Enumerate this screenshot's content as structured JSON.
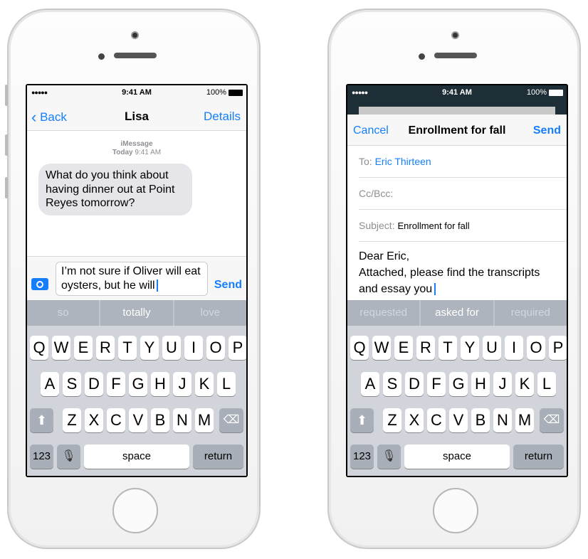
{
  "phones": [
    {
      "status": {
        "time": "9:41 AM",
        "battery": "100%"
      },
      "nav": {
        "back": "Back",
        "title": "Lisa",
        "right": "Details"
      },
      "thread": {
        "service": "iMessage",
        "day": "Today",
        "time": "9:41 AM",
        "incoming": "What do you think about having dinner out at Point Reyes tomorrow?"
      },
      "compose": {
        "text": "I’m not sure if Oliver will eat oysters, but he will",
        "send": "Send"
      },
      "suggestions": [
        "so",
        "totally",
        "love"
      ]
    },
    {
      "status": {
        "time": "9:41 AM",
        "battery": "100%"
      },
      "nav": {
        "back": "Cancel",
        "title": "Enrollment for fall",
        "right": "Send"
      },
      "mail": {
        "to_label": "To:",
        "to": "Eric Thirteen",
        "cc_label": "Cc/Bcc:",
        "subject_label": "Subject:",
        "subject": "Enrollment for fall",
        "body_line1": "Dear Eric,",
        "body_line2": "Attached, please find the transcripts",
        "body_line3": "and essay you"
      },
      "suggestions": [
        "requested",
        "asked for",
        "required"
      ]
    }
  ],
  "keyboard": {
    "rows": [
      [
        "Q",
        "W",
        "E",
        "R",
        "T",
        "Y",
        "U",
        "I",
        "O",
        "P"
      ],
      [
        "A",
        "S",
        "D",
        "F",
        "G",
        "H",
        "J",
        "K",
        "L"
      ],
      [
        "Z",
        "X",
        "C",
        "V",
        "B",
        "N",
        "M"
      ]
    ],
    "numbers": "123",
    "space": "space",
    "return": "return"
  },
  "colors": {
    "accent": "#157efb",
    "keyboard": "#d1d5db",
    "suggestion_bar": "#aeb4bd"
  }
}
